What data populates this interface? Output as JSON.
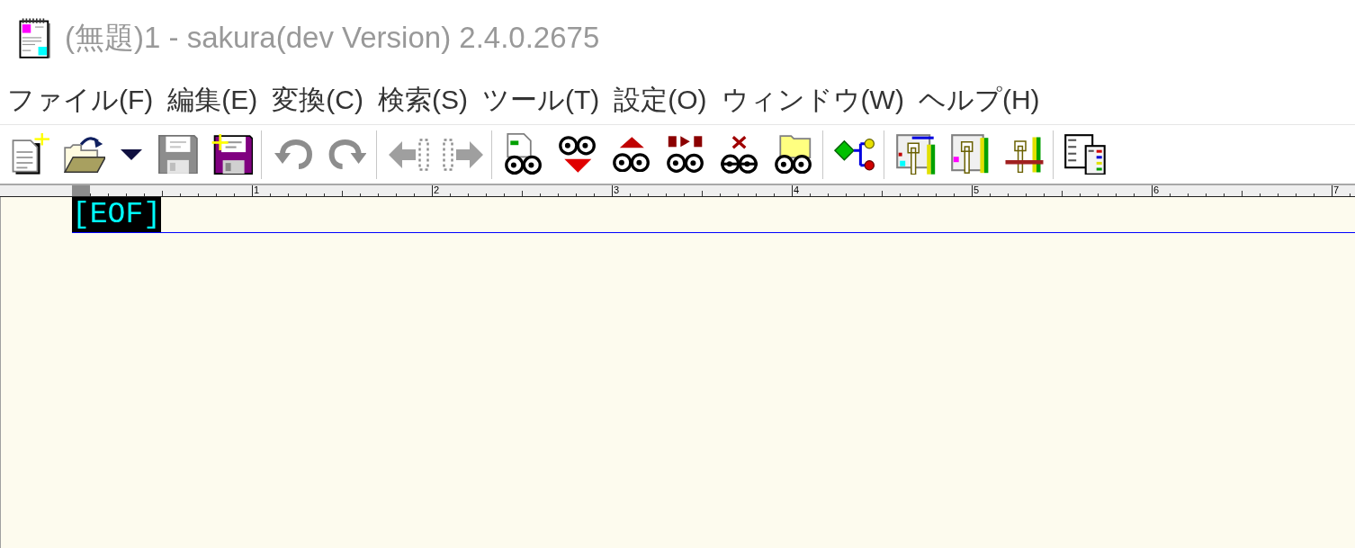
{
  "window": {
    "title": "(無題)1 - sakura(dev Version) 2.4.0.2675"
  },
  "menu_bar": [
    "ファイル(F)",
    "編集(E)",
    "変換(C)",
    "検索(S)",
    "ツール(T)",
    "設定(O)",
    "ウィンドウ(W)",
    "ヘルプ(H)"
  ],
  "toolbar": [
    {
      "buttons": [
        {
          "kind": "button",
          "disabled": false
        },
        {
          "kind": "button",
          "disabled": false
        },
        {
          "kind": "dropdown",
          "disabled": false
        },
        {
          "kind": "button",
          "disabled": true
        },
        {
          "kind": "button",
          "disabled": false
        }
      ]
    },
    {
      "buttons": [
        {
          "kind": "button",
          "disabled": true
        },
        {
          "kind": "button",
          "disabled": true
        }
      ]
    },
    {
      "buttons": [
        {
          "kind": "button",
          "disabled": true
        },
        {
          "kind": "button",
          "disabled": true
        }
      ]
    },
    {
      "buttons": [
        {
          "kind": "button",
          "disabled": false
        },
        {
          "kind": "button",
          "disabled": false
        },
        {
          "kind": "button",
          "disabled": false
        },
        {
          "kind": "button",
          "disabled": false
        },
        {
          "kind": "button",
          "disabled": false
        },
        {
          "kind": "button",
          "disabled": false
        }
      ]
    },
    {
      "buttons": [
        {
          "kind": "button",
          "disabled": false
        }
      ]
    },
    {
      "buttons": [
        {
          "kind": "button",
          "disabled": false
        },
        {
          "kind": "button",
          "disabled": false
        },
        {
          "kind": "button",
          "disabled": false
        }
      ]
    },
    {
      "buttons": [
        {
          "kind": "button",
          "disabled": false
        }
      ]
    }
  ],
  "ruler": {
    "labels": [
      "1",
      "2",
      "3",
      "4",
      "5",
      "6",
      "7"
    ]
  },
  "editor": {
    "eof_marker": "[EOF]"
  }
}
